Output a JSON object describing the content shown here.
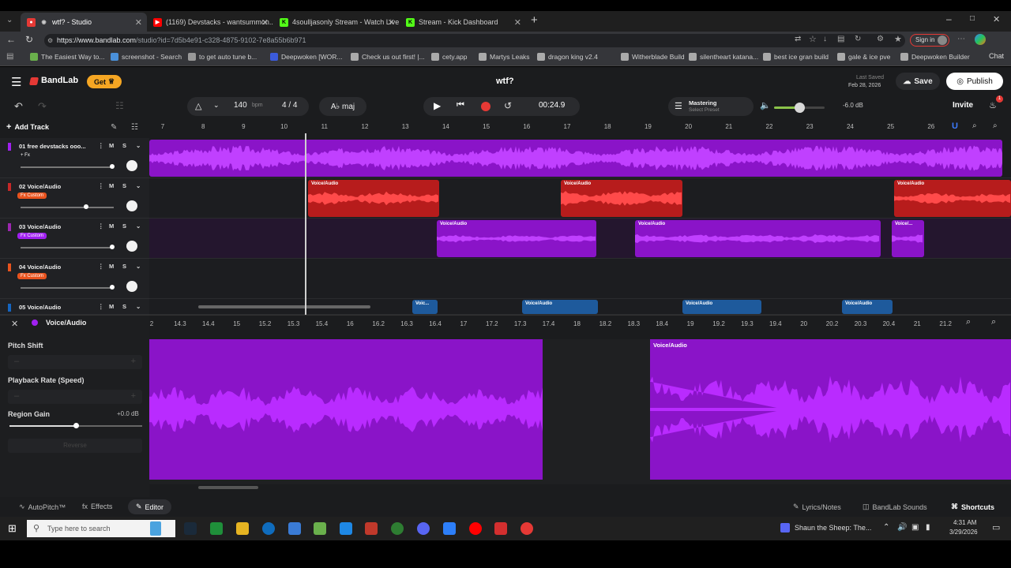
{
  "browser": {
    "tabs": [
      {
        "title": "wtf? - Studio",
        "icon_color": "#e53935"
      },
      {
        "title": "(1169) Devstacks - wantsummon...",
        "icon_color": "#ff0000"
      },
      {
        "title": "4soulljasonly Stream - Watch Live",
        "icon_color": "#53fc18"
      },
      {
        "title": "Stream - Kick Dashboard",
        "icon_color": "#53fc18"
      }
    ],
    "url_host": "https://www.bandlab.com",
    "url_path": "/studio?id=7d5b4e91-c328-4875-9102-7e8a55b6b971",
    "signin_label": "Sign in",
    "bookmarks": [
      "The Easiest Way to...",
      "screenshot - Search",
      "to get auto tune b...",
      "Deepwoken [WOR...",
      "Check us out first! |...",
      "cety.app",
      "Martys Leaks",
      "dragon king v2.4",
      "Witherblade Build",
      "silentheart katana...",
      "best ice gran build",
      "gale & ice pve",
      "Deepwoken Builder"
    ],
    "bookmark_colors": [
      "#6ab04c",
      "#4a90d9",
      "#999",
      "#3b5bdb",
      "#aaa",
      "#aaa",
      "#aaa",
      "#aaa",
      "#aaa",
      "#aaa",
      "#aaa",
      "#aaa",
      "#aaa"
    ]
  },
  "app": {
    "logo_text": "BandLab",
    "get_label": "Get",
    "project_title": "wtf?",
    "last_saved_label": "Last Saved",
    "last_saved_date": "Feb 28, 2026",
    "save_label": "Save",
    "publish_label": "Publish",
    "invite_label": "Invite",
    "notif_count": "1",
    "tempo": "140",
    "tempo_unit": "bpm",
    "time_sig": "4 / 4",
    "key": "A♭ maj",
    "time_display": "00:24.9",
    "mastering_label": "Mastering",
    "mastering_preset": "Select Preset",
    "volume_db": "-6.0 dB",
    "volume_level": 0.5,
    "add_track_label": "Add Track"
  },
  "ruler_ticks": [
    "7",
    "8",
    "9",
    "10",
    "11",
    "12",
    "13",
    "14",
    "15",
    "16",
    "17",
    "18",
    "19",
    "20",
    "21",
    "22",
    "23",
    "24",
    "25",
    "26"
  ],
  "tracks": [
    {
      "num": "01",
      "name": "free devstacks ooo...",
      "tag": "+ Fx",
      "tag_color": "transparent",
      "color": "#a020f0",
      "volume": 0.98
    },
    {
      "num": "02",
      "name": "Voice/Audio",
      "tag": "Fx Custom",
      "tag_color": "#e8531e",
      "color": "#c62828",
      "volume": 0.7
    },
    {
      "num": "03",
      "name": "Voice/Audio",
      "tag": "Fx Custom",
      "tag_color": "#a020f0",
      "color": "#9c27b0",
      "volume": 0.98
    },
    {
      "num": "04",
      "name": "Voice/Audio",
      "tag": "Fx Custom",
      "tag_color": "#e8531e",
      "color": "#e8531e",
      "volume": 0.98
    },
    {
      "num": "05",
      "name": "Voice/Audio",
      "tag": "",
      "tag_color": "transparent",
      "color": "#1565c0",
      "volume": 0.98
    }
  ],
  "region_label": "Voice/Audio",
  "region_label_short": "Voice/...",
  "region_label_tiny": "Voic...",
  "editor": {
    "track_name": "Voice/Audio",
    "pitch_shift_label": "Pitch Shift",
    "playback_rate_label": "Playback Rate (Speed)",
    "region_gain_label": "Region Gain",
    "region_gain_value": "+0.0 dB",
    "region_gain_level": 0.5,
    "reverse_label": "Reverse",
    "ruler_ticks": [
      "2",
      "14.3",
      "14.4",
      "15",
      "15.2",
      "15.3",
      "15.4",
      "16",
      "16.2",
      "16.3",
      "16.4",
      "17",
      "17.2",
      "17.3",
      "17.4",
      "18",
      "18.2",
      "18.3",
      "18.4",
      "19",
      "19.2",
      "19.3",
      "19.4",
      "20",
      "20.2",
      "20.3",
      "20.4",
      "21",
      "21.2"
    ],
    "region_label": "Voice/Audio"
  },
  "footer": {
    "autopitch": "AutoPitch™",
    "effects": "Effects",
    "editor": "Editor",
    "lyrics": "Lyrics/Notes",
    "sounds": "BandLab Sounds",
    "shortcuts": "Shortcuts"
  },
  "taskbar": {
    "search_placeholder": "Type here to search",
    "media_title": "Shaun the Sheep: The...",
    "time": "4:31 AM",
    "date": "3/29/2026"
  }
}
